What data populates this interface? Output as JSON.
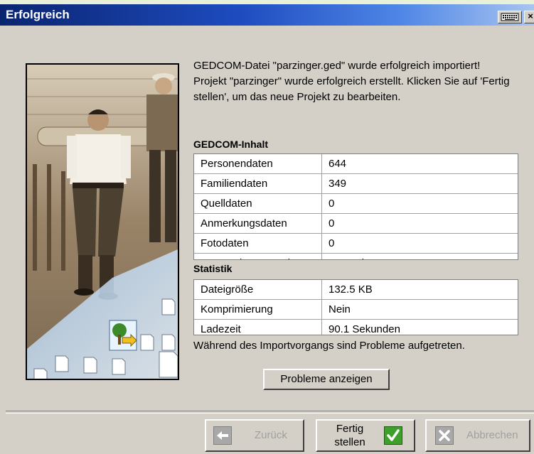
{
  "window": {
    "title": "Erfolgreich"
  },
  "message": {
    "line1": "GEDCOM-Datei \"parzinger.ged\" wurde erfolgreich importiert!",
    "line2": "Projekt \"parzinger\" wurde erfolgreich erstellt. Klicken Sie auf 'Fertig stellen', um das neue Projekt zu bearbeiten."
  },
  "gedcom": {
    "title": "GEDCOM-Inhalt",
    "rows": [
      {
        "label": "Personendaten",
        "value": "644"
      },
      {
        "label": "Familiendaten",
        "value": "349"
      },
      {
        "label": "Quelldaten",
        "value": "0"
      },
      {
        "label": "Anmerkungsdaten",
        "value": "0"
      },
      {
        "label": "Fotodaten",
        "value": "0"
      },
      {
        "label": "Verwendete Sprache",
        "value": "Deutsch"
      }
    ]
  },
  "stats": {
    "title": "Statistik",
    "rows": [
      {
        "label": "Dateigröße",
        "value": "132.5 KB"
      },
      {
        "label": "Komprimierung",
        "value": "Nein"
      },
      {
        "label": "Ladezeit",
        "value": "90.1 Sekunden"
      }
    ]
  },
  "warning": "Während des Importvorgangs sind Probleme aufgetreten.",
  "buttons": {
    "show_problems": "Probleme anzeigen",
    "back": "Zurück",
    "finish_line1": "Fertig",
    "finish_line2": "stellen",
    "cancel": "Abbrechen"
  },
  "colors": {
    "accent_green": "#3ea02a",
    "title_blue": "#0a2470"
  }
}
